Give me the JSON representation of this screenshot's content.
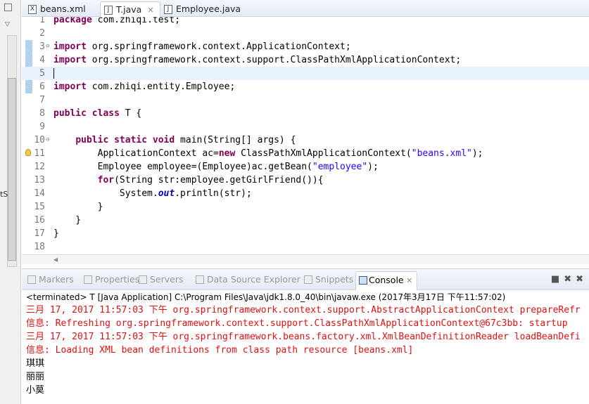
{
  "left_strip": {
    "partial_text": "tS"
  },
  "tabs": [
    {
      "label": "beans.xml",
      "icon": "xml-file-icon",
      "active": false
    },
    {
      "label": "T.java",
      "icon": "java-file-warning-icon",
      "active": true
    },
    {
      "label": "Employee.java",
      "icon": "java-file-icon",
      "active": false
    }
  ],
  "editor": {
    "current_line": 5,
    "lines": [
      {
        "n": "1",
        "t": [
          [
            "kw",
            "package"
          ],
          [
            "p",
            " com.zhiqi.test;"
          ]
        ]
      },
      {
        "n": "2",
        "t": []
      },
      {
        "n": "3",
        "fold": true,
        "t": [
          [
            "kw",
            "import"
          ],
          [
            "p",
            " org.springframework.context.ApplicationContext;"
          ]
        ]
      },
      {
        "n": "4",
        "t": [
          [
            "kw",
            "import"
          ],
          [
            "p",
            " org.springframework.context.support.ClassPathXmlApplicationContext;"
          ]
        ]
      },
      {
        "n": "5",
        "t": []
      },
      {
        "n": "6",
        "t": [
          [
            "kw",
            "import"
          ],
          [
            "p",
            " com.zhiqi.entity.Employee;"
          ]
        ]
      },
      {
        "n": "7",
        "t": []
      },
      {
        "n": "8",
        "t": [
          [
            "kw",
            "public"
          ],
          [
            "p",
            " "
          ],
          [
            "kw",
            "class"
          ],
          [
            "p",
            " T {"
          ]
        ]
      },
      {
        "n": "9",
        "t": []
      },
      {
        "n": "10",
        "fold": true,
        "t": [
          [
            "p",
            "    "
          ],
          [
            "kw",
            "public"
          ],
          [
            "p",
            " "
          ],
          [
            "kw",
            "static"
          ],
          [
            "p",
            " "
          ],
          [
            "kw",
            "void"
          ],
          [
            "p",
            " main(String[] args) {"
          ]
        ]
      },
      {
        "n": "11",
        "warn": true,
        "t": [
          [
            "p",
            "        ApplicationContext "
          ],
          [
            "var",
            "ac"
          ],
          [
            "p",
            "="
          ],
          [
            "kw",
            "new"
          ],
          [
            "p",
            " ClassPathXmlApplicationContext("
          ],
          [
            "str",
            "\"beans.xml\""
          ],
          [
            "p",
            ");"
          ]
        ]
      },
      {
        "n": "12",
        "t": [
          [
            "p",
            "        Employee "
          ],
          [
            "var",
            "employee"
          ],
          [
            "p",
            "=(Employee)"
          ],
          [
            "var",
            "ac"
          ],
          [
            "p",
            ".getBean("
          ],
          [
            "str",
            "\"employee\""
          ],
          [
            "p",
            ");"
          ]
        ]
      },
      {
        "n": "13",
        "t": [
          [
            "p",
            "        "
          ],
          [
            "kw",
            "for"
          ],
          [
            "p",
            "(String "
          ],
          [
            "var",
            "str"
          ],
          [
            "p",
            ":"
          ],
          [
            "var",
            "employee"
          ],
          [
            "p",
            ".getGirlFriend()){"
          ]
        ]
      },
      {
        "n": "14",
        "t": [
          [
            "p",
            "            System."
          ],
          [
            "fld",
            "out"
          ],
          [
            "p",
            ".println("
          ],
          [
            "var",
            "str"
          ],
          [
            "p",
            ");"
          ]
        ]
      },
      {
        "n": "15",
        "t": [
          [
            "p",
            "        }"
          ]
        ]
      },
      {
        "n": "16",
        "t": [
          [
            "p",
            "    }"
          ]
        ]
      },
      {
        "n": "17",
        "t": [
          [
            "p",
            "}"
          ]
        ]
      },
      {
        "n": "18",
        "t": []
      }
    ]
  },
  "panel": {
    "tabs": [
      {
        "label": "Markers",
        "icon": "markers-icon"
      },
      {
        "label": "Properties",
        "icon": "properties-icon"
      },
      {
        "label": "Servers",
        "icon": "servers-icon"
      },
      {
        "label": "Data Source Explorer",
        "icon": "data-source-icon"
      },
      {
        "label": "Snippets",
        "icon": "snippets-icon"
      },
      {
        "label": "Console",
        "icon": "console-icon",
        "active": true
      }
    ],
    "tools": [
      "■",
      "✖",
      "✖"
    ],
    "console_header": "<terminated> T [Java Application] C:\\Program Files\\Java\\jdk1.8.0_40\\bin\\javaw.exe (2017年3月17日 下午11:57:02)",
    "output": [
      {
        "type": "err",
        "text": "三月 17, 2017 11:57:03 下午 org.springframework.context.support.AbstractApplicationContext prepareRefr"
      },
      {
        "type": "err",
        "text": "信息: Refreshing org.springframework.context.support.ClassPathXmlApplicationContext@67c3bb: startup"
      },
      {
        "type": "err",
        "text": "三月 17, 2017 11:57:03 下午 org.springframework.beans.factory.xml.XmlBeanDefinitionReader loadBeanDefi"
      },
      {
        "type": "err",
        "text": "信息: Loading XML bean definitions from class path resource [beans.xml]"
      },
      {
        "type": "std",
        "text": "琪琪"
      },
      {
        "type": "std",
        "text": "丽丽"
      },
      {
        "type": "std",
        "text": "小莫"
      }
    ],
    "colors": {
      "stderr": "#e01010",
      "stdout": "#000000"
    }
  }
}
